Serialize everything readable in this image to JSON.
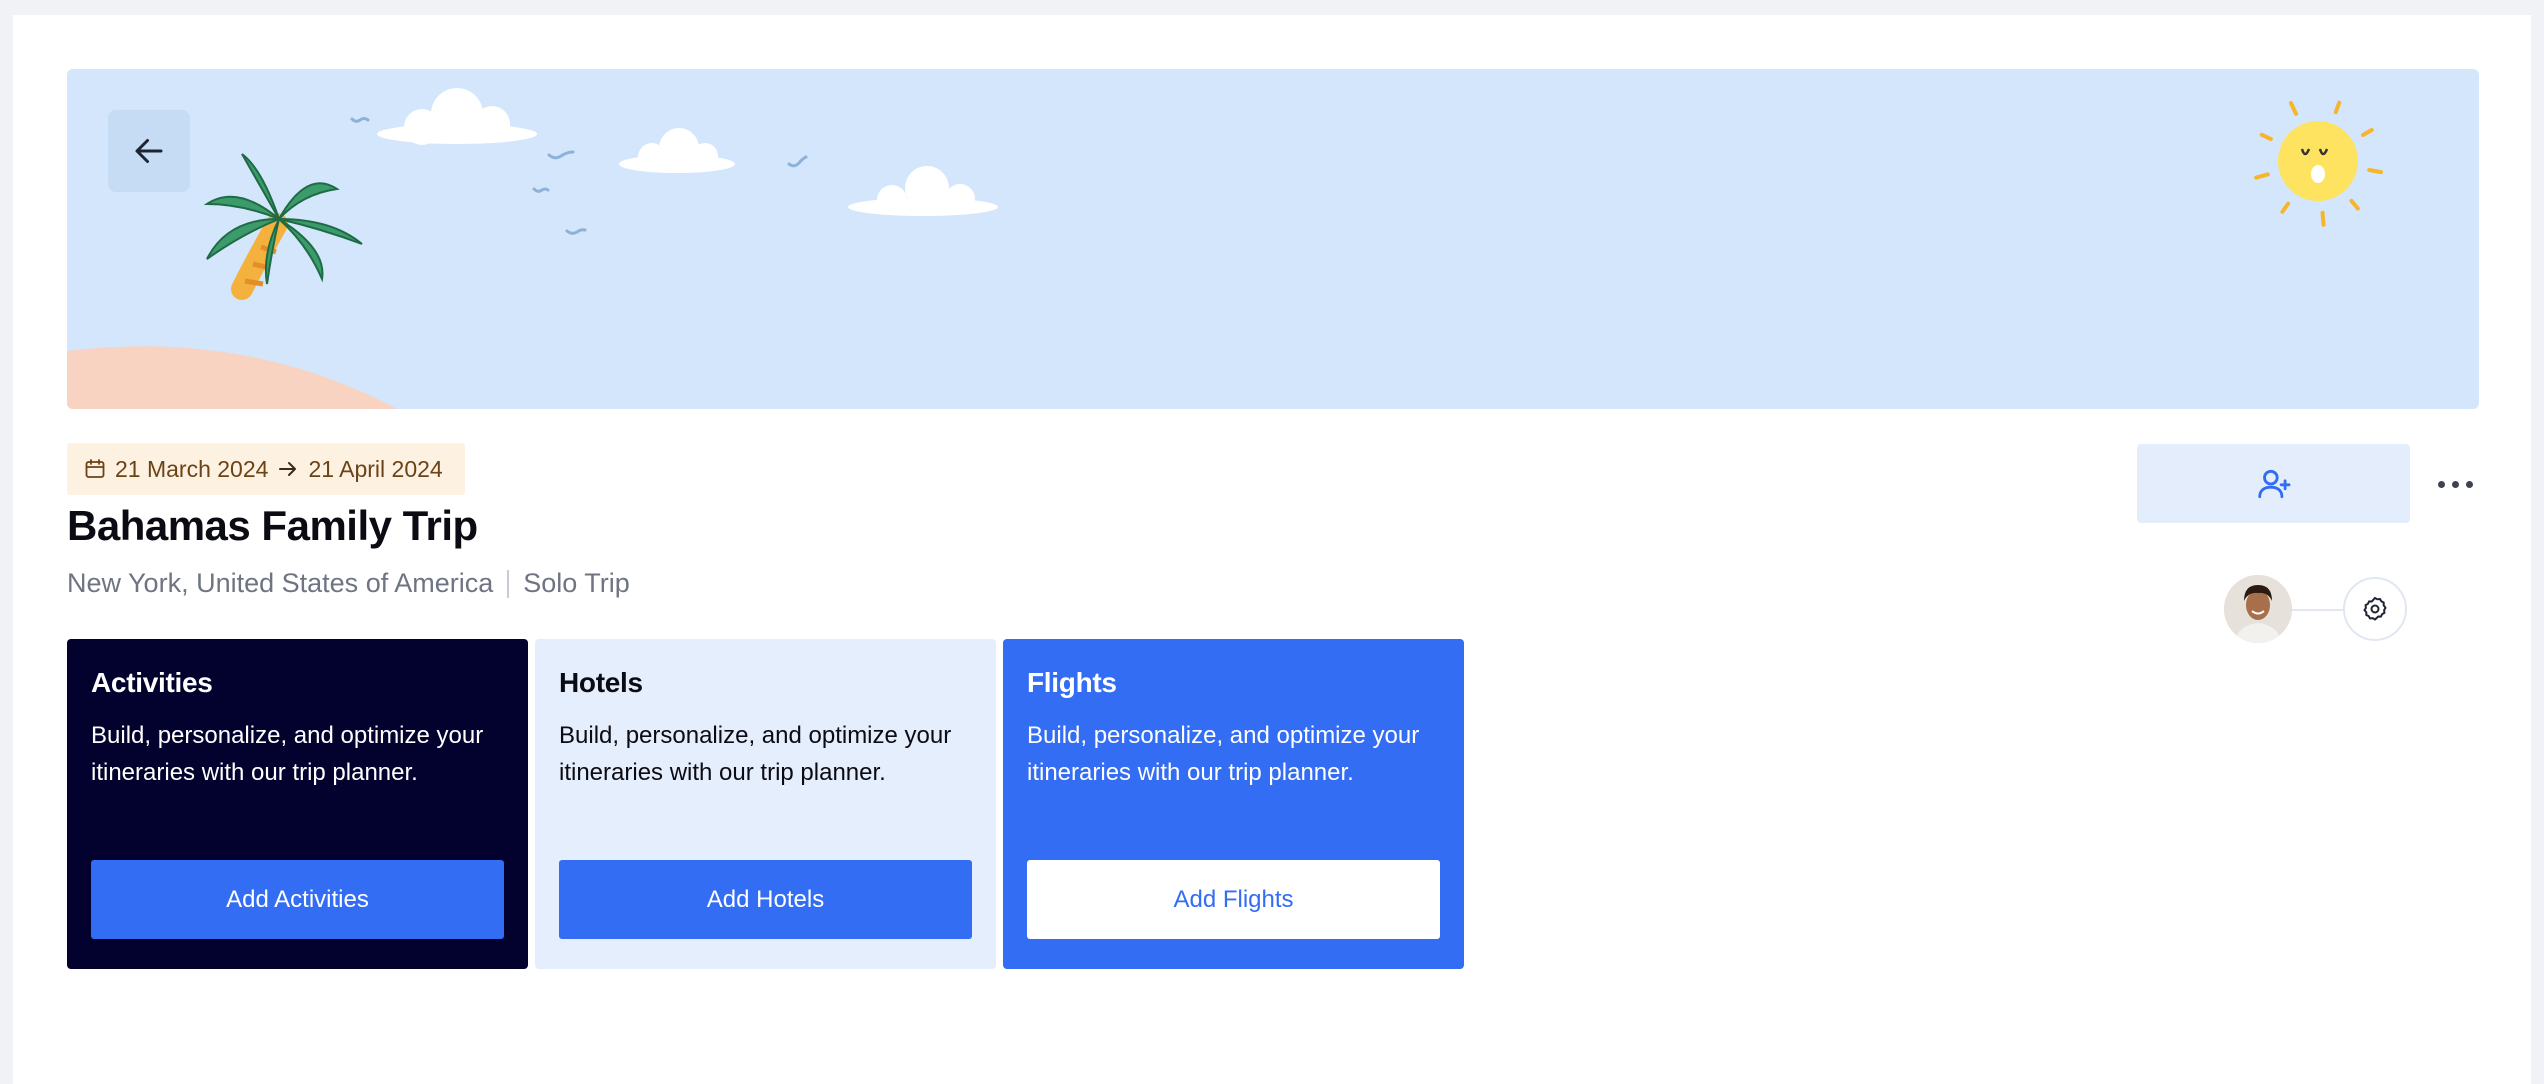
{
  "header": {
    "back_icon": "arrow-left-icon",
    "banner_illustration": "beach-palm-tree-sun-clouds"
  },
  "trip": {
    "start_date": "21 March 2024",
    "end_date": "21 April 2024",
    "title": "Bahamas Family Trip",
    "city": "New York,",
    "country": "United States of America",
    "trip_type": "Solo Trip"
  },
  "actions": {
    "invite_icon": "user-plus-icon",
    "more_icon": "more-horizontal-icon",
    "settings_icon": "gear-icon"
  },
  "cards": [
    {
      "title": "Activities",
      "description": "Build, personalize, and optimize your itineraries with our trip planner.",
      "button_label": "Add Activities"
    },
    {
      "title": "Hotels",
      "description": "Build, personalize, and optimize your itineraries with our trip planner.",
      "button_label": "Add Hotels"
    },
    {
      "title": "Flights",
      "description": "Build, personalize, and optimize your itineraries with our trip planner.",
      "button_label": "Add Flights"
    }
  ],
  "colors": {
    "primary": "#336df4",
    "navy": "#03022e",
    "light_blue": "#e5eefc",
    "banner_sky": "#d3e6fb",
    "date_badge_bg": "#fdf1e1"
  }
}
